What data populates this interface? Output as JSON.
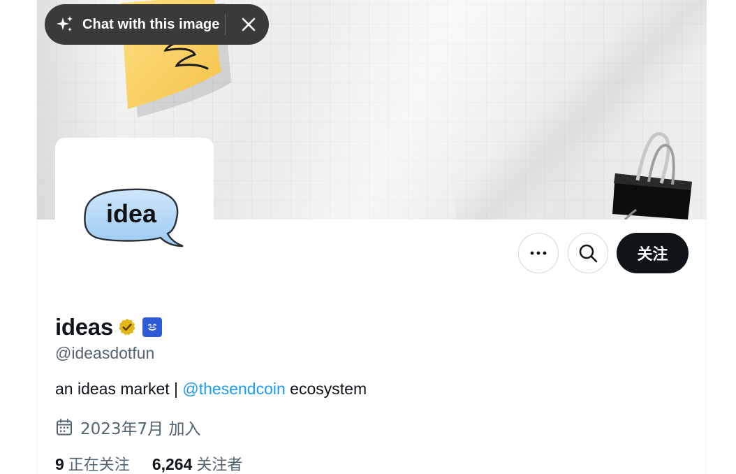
{
  "overlay": {
    "chat_label": "Chat with this image"
  },
  "profile": {
    "display_name": "ideas",
    "handle": "@ideasdotfun",
    "avatar_text": "idea",
    "bio_prefix": "an ideas market | ",
    "bio_mention": "@thesendcoin",
    "bio_suffix": " ecosystem",
    "joined": "2023年7月 加入",
    "following_count": "9",
    "following_label": "正在关注",
    "followers_count": "6,264",
    "followers_label": "关注者"
  },
  "actions": {
    "follow_label": "关注"
  },
  "icons": {
    "sparkle": "sparkle-icon",
    "close": "close-icon",
    "more": "more-icon",
    "search": "search-icon",
    "verified": "verified-badge-icon",
    "affiliate": "affiliate-badge-icon",
    "calendar": "calendar-icon"
  },
  "colors": {
    "accent": "#1d9bf0",
    "follow_button": "#0f1419",
    "secondary_text": "#536471",
    "verified_gold": "#e2b719",
    "affiliate_blue": "#2f5bd8"
  }
}
